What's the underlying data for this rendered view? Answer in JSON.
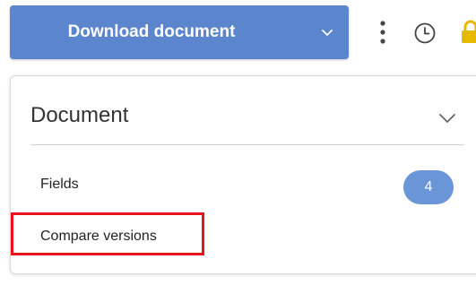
{
  "toolbar": {
    "download_label": "Download document",
    "download_chevron_icon": "chevron-down-icon",
    "more_icon": "more-vertical-icon",
    "history_icon": "clock-icon",
    "lock_icon": "lock-icon",
    "accent_color": "#5b85cc",
    "lock_color": "#e6b800"
  },
  "panel": {
    "title": "Document",
    "collapse_icon": "chevron-down-icon",
    "items": [
      {
        "label": "Fields",
        "count": "4"
      },
      {
        "label": "Compare versions"
      }
    ]
  },
  "highlight": {
    "color": "#e8141b"
  }
}
